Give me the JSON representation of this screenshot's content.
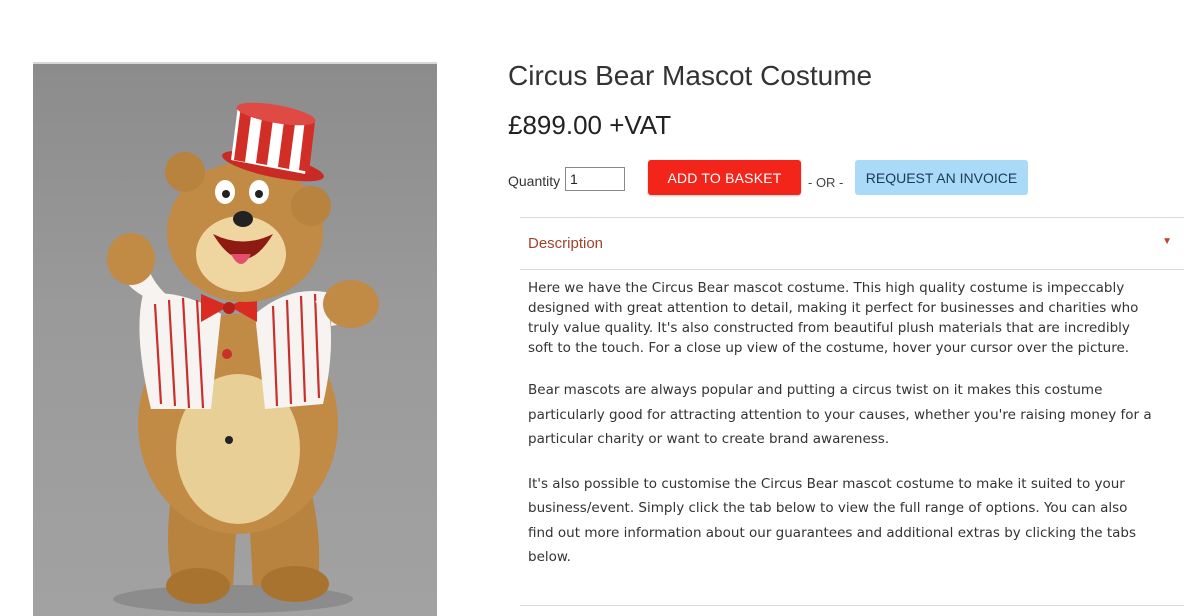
{
  "product": {
    "title": "Circus Bear Mascot Costume",
    "price": "£899.00 +VAT",
    "image_alt": "circus-bear-mascot-costume-photo"
  },
  "purchase": {
    "quantity_label": "Quantity",
    "quantity_value": "1",
    "add_to_basket_label": "ADD TO BASKET",
    "separator": "- OR -",
    "request_invoice_label": "REQUEST AN INVOICE"
  },
  "accordion": {
    "title": "Description",
    "caret_icon": "caret-down-icon",
    "paragraphs": [
      "Here we have the Circus Bear mascot costume. This high quality costume is impeccably\ndesigned with great attention to detail, making it perfect for businesses and charities who\ntruly value quality. It's also constructed from beautiful plush materials that are incredibly\nsoft to the touch. For a close up view of the costume, hover your cursor over the picture.",
      "Bear mascots are always popular and putting a circus twist on it makes this costume\nparticularly good for attracting attention to your causes, whether you're raising money for a\nparticular charity or want to create brand awareness.",
      "It's also possible to customise the Circus Bear mascot costume to make it suited to your\nbusiness/event. Simply click the tab below to view the full range of options. You can also\nfind out more information about our guarantees and additional extras by clicking the tabs\nbelow."
    ]
  },
  "colors": {
    "add_button": "#f3241a",
    "invoice_button": "#a9daf7",
    "accent_text": "#a0432a"
  }
}
